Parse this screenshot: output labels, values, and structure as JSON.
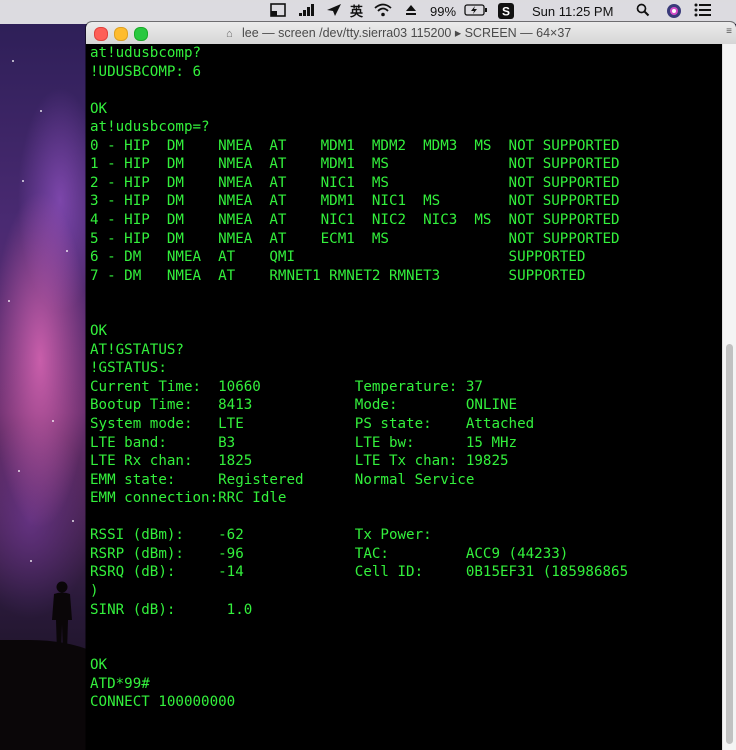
{
  "menubar": {
    "battery_percent": "99%",
    "clock": "Sun 11:25 PM",
    "input_method": "英",
    "icons": [
      "window-icon",
      "signal-bars-icon",
      "location-arrow-icon",
      "input-method-icon",
      "wifi-icon",
      "eject-icon",
      "battery-charging-icon",
      "s-app-icon",
      "spotlight-search-icon",
      "siri-icon",
      "notification-list-icon"
    ]
  },
  "window": {
    "title": "lee — screen /dev/tty.sierra03 115200 ▸ SCREEN — 64×37",
    "text_color": "#33f03c",
    "background": "#000000"
  },
  "terminal_lines": [
    "at!udusbcomp?",
    "!UDUSBCOMP: 6",
    "",
    "OK",
    "at!udusbcomp=?",
    "0 - HIP  DM    NMEA  AT    MDM1  MDM2  MDM3  MS  NOT SUPPORTED",
    "1 - HIP  DM    NMEA  AT    MDM1  MS              NOT SUPPORTED",
    "2 - HIP  DM    NMEA  AT    NIC1  MS              NOT SUPPORTED",
    "3 - HIP  DM    NMEA  AT    MDM1  NIC1  MS        NOT SUPPORTED",
    "4 - HIP  DM    NMEA  AT    NIC1  NIC2  NIC3  MS  NOT SUPPORTED",
    "5 - HIP  DM    NMEA  AT    ECM1  MS              NOT SUPPORTED",
    "6 - DM   NMEA  AT    QMI                         SUPPORTED",
    "7 - DM   NMEA  AT    RMNET1 RMNET2 RMNET3        SUPPORTED",
    "",
    "",
    "OK",
    "AT!GSTATUS?",
    "!GSTATUS:",
    "Current Time:  10660           Temperature: 37",
    "Bootup Time:   8413            Mode:        ONLINE",
    "System mode:   LTE             PS state:    Attached",
    "LTE band:      B3              LTE bw:      15 MHz",
    "LTE Rx chan:   1825            LTE Tx chan: 19825",
    "EMM state:     Registered      Normal Service",
    "EMM connection:RRC Idle",
    "",
    "RSSI (dBm):    -62             Tx Power:",
    "RSRP (dBm):    -96             TAC:         ACC9 (44233)",
    "RSRQ (dB):     -14             Cell ID:     0B15EF31 (185986865",
    ")",
    "SINR (dB):      1.0",
    "",
    "",
    "OK",
    "ATD*99#",
    "CONNECT 100000000",
    ""
  ]
}
